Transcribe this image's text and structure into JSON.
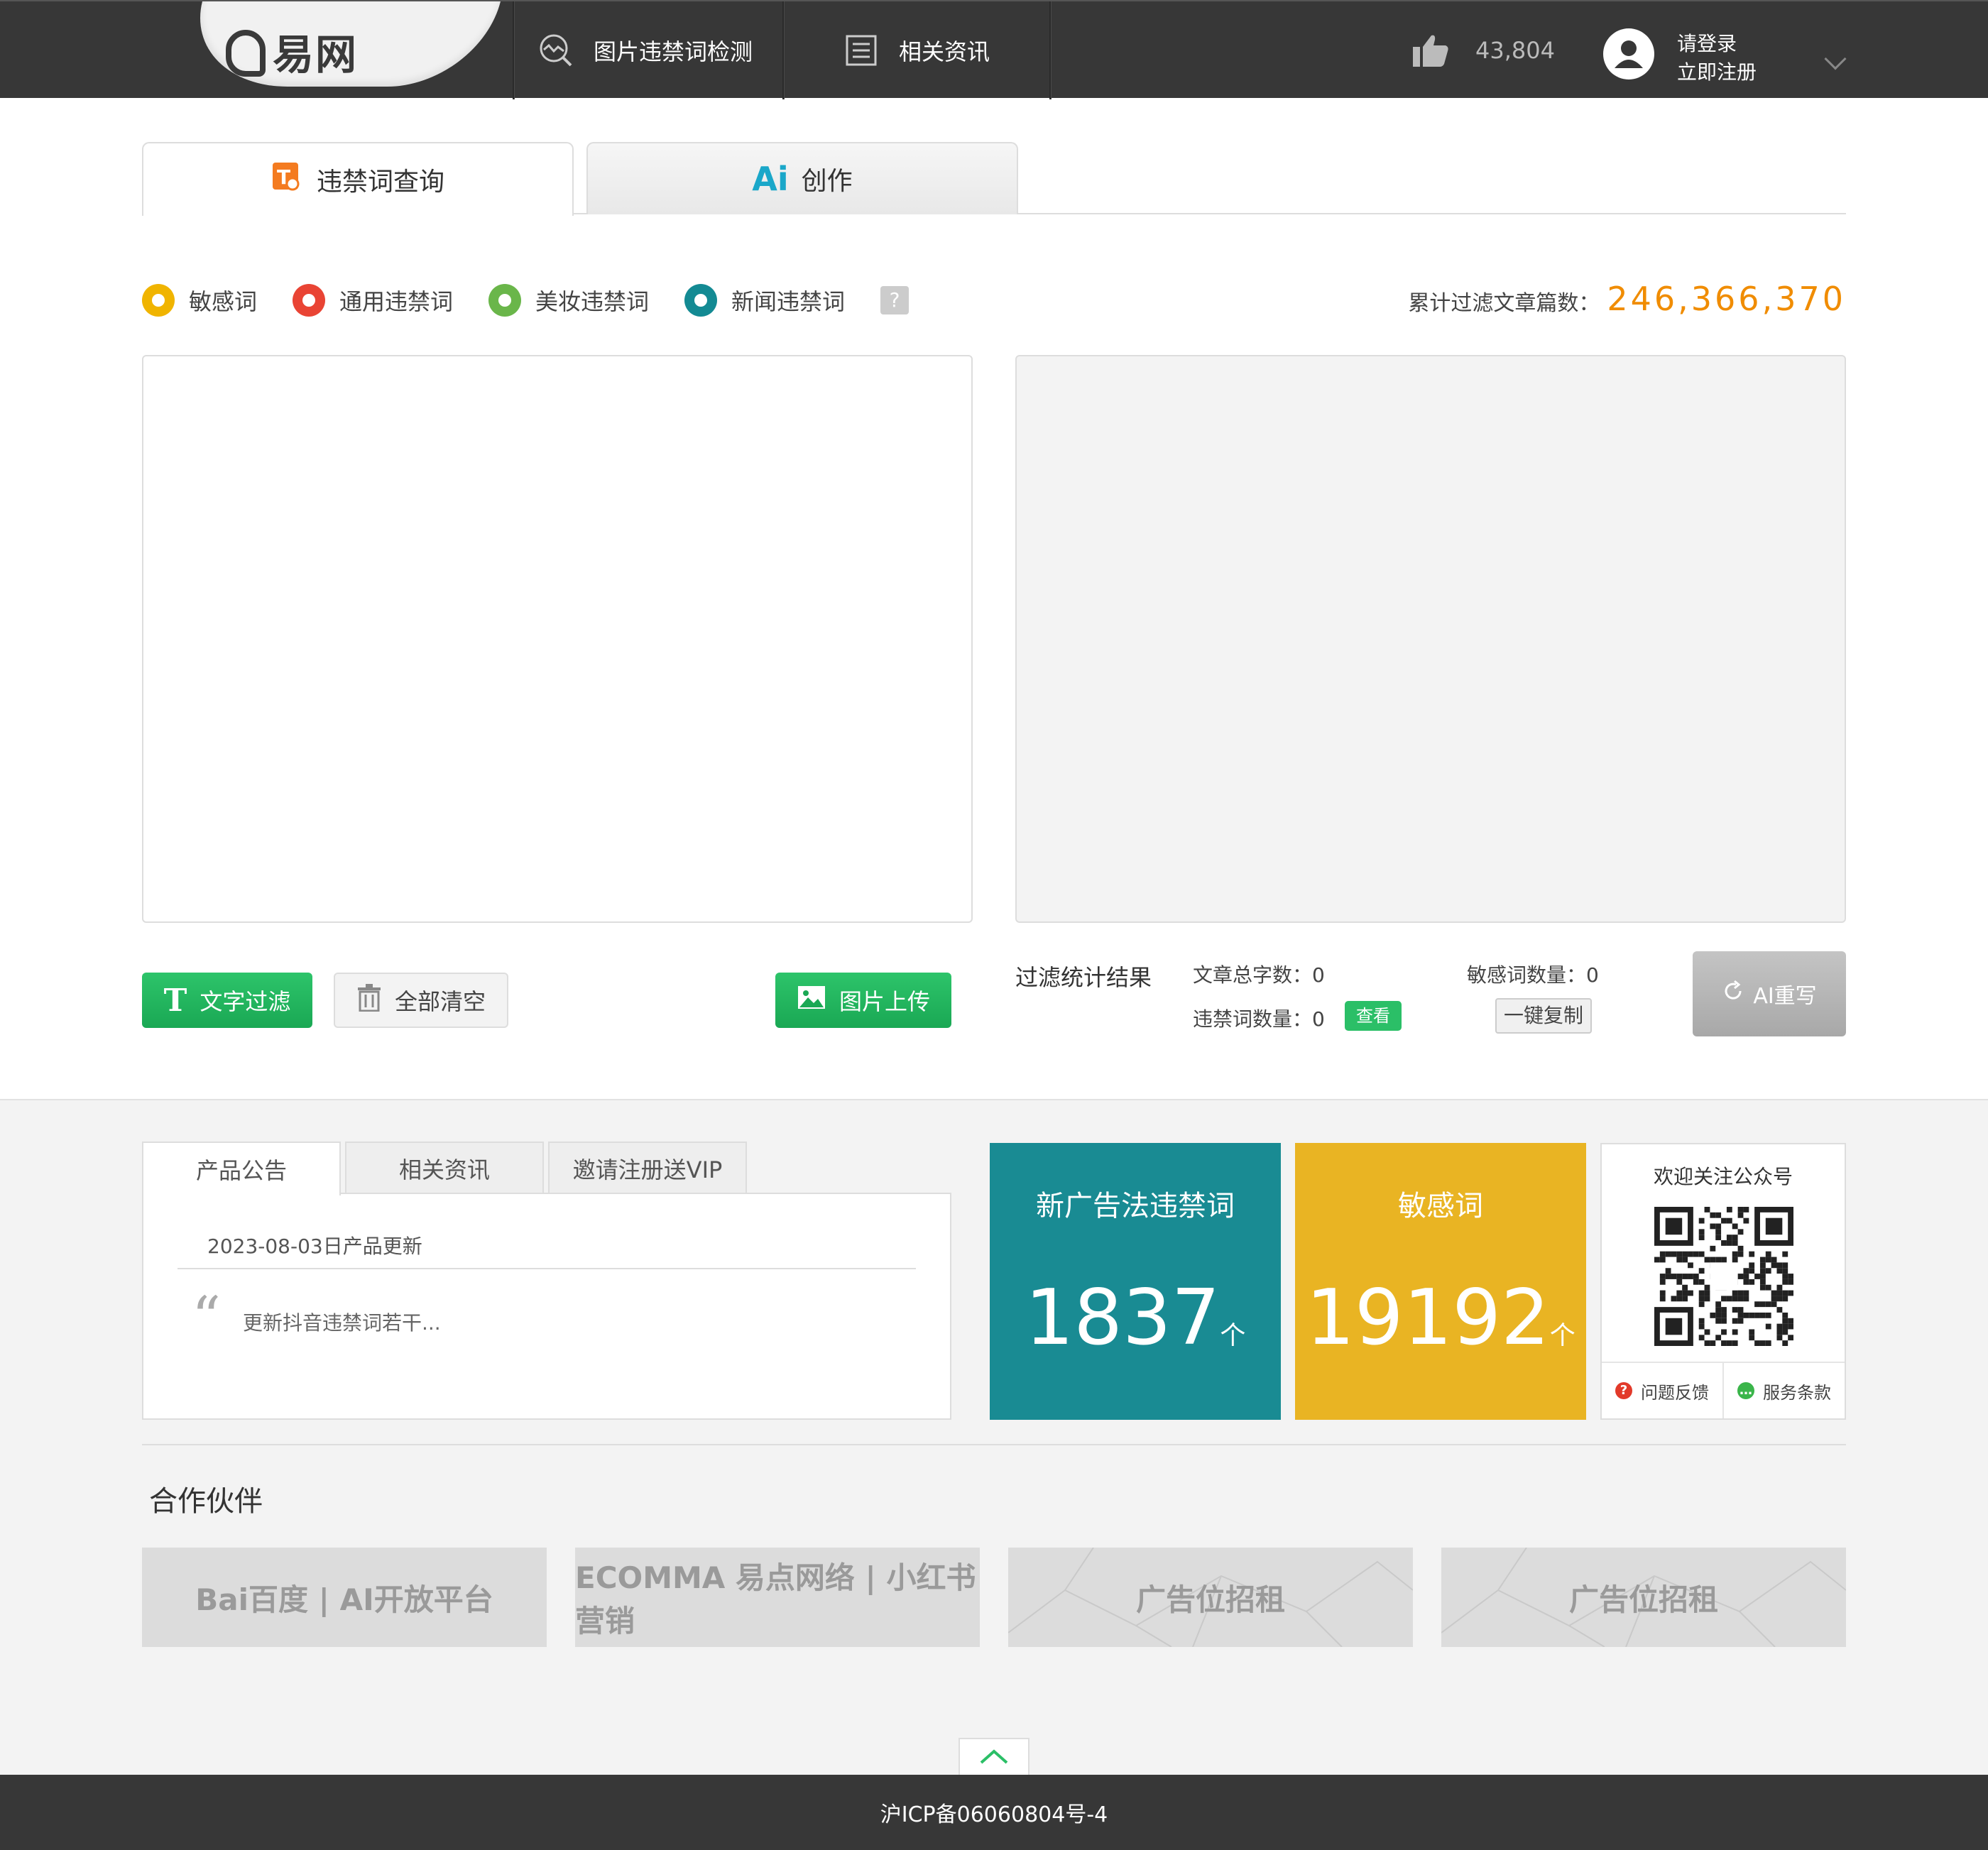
{
  "header": {
    "logo_text": "易网",
    "nav": [
      {
        "label": "图片违禁词检测",
        "icon": "image-scan-icon"
      },
      {
        "label": "相关资讯",
        "icon": "news-doc-icon"
      }
    ],
    "likes_count": "43,804",
    "login_label": "请登录",
    "register_label": "立即注册"
  },
  "tabs": [
    {
      "label": "违禁词查询",
      "icon": "search-doc-icon",
      "active": true
    },
    {
      "label": "创作",
      "icon": "ai-icon",
      "active": false
    }
  ],
  "ai_badge": "Ai",
  "legend": [
    {
      "label": "敏感词",
      "color": "#f0b400"
    },
    {
      "label": "通用违禁词",
      "color": "#e94434"
    },
    {
      "label": "美妆违禁词",
      "color": "#6ab64a"
    },
    {
      "label": "新闻违禁词",
      "color": "#138a93"
    }
  ],
  "help_mark": "?",
  "total": {
    "label": "累计过滤文章篇数：",
    "value": "246,366,370"
  },
  "buttons": {
    "text_filter": "文字过滤",
    "clear_all": "全部清空",
    "image_upload": "图片上传",
    "ai_rewrite": "AI重写"
  },
  "stats": {
    "title": "过滤统计结果",
    "total_chars_label": "文章总字数：",
    "total_chars": "0",
    "sensitive_label": "敏感词数量：",
    "sensitive_count": "0",
    "banned_label": "违禁词数量：",
    "banned_count": "0",
    "view_label": "查看",
    "copy_label": "一键复制"
  },
  "news": {
    "tabs": [
      "产品公告",
      "相关资讯",
      "邀请注册送VIP"
    ],
    "date_line": "2023-08-03日产品更新",
    "quote_mark": "“",
    "content": "更新抖音违禁词若干..."
  },
  "cards": [
    {
      "title": "新广告法违禁词",
      "count": "1837",
      "unit": "个",
      "color": "#198b93"
    },
    {
      "title": "敏感词",
      "count": "19192",
      "unit": "个",
      "color": "#e9b423"
    }
  ],
  "qr": {
    "title": "欢迎关注公众号",
    "feedback": "问题反馈",
    "terms": "服务条款"
  },
  "partners": {
    "title": "合作伙伴",
    "items": [
      "Bai百度 | AI开放平台",
      "ECOMMA 易点网络 | 小红书营销",
      "广告位招租",
      "广告位招租"
    ]
  },
  "footer": {
    "icp": "沪ICP备06060804号-4"
  }
}
